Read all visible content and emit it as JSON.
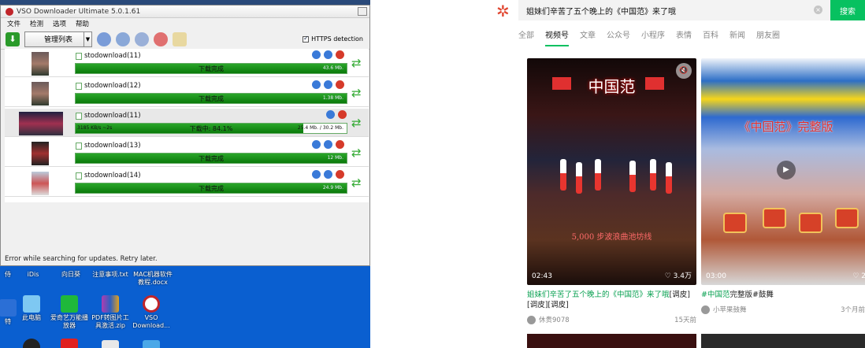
{
  "vso": {
    "title": "VSO Downloader Ultimate 5.0.1.61",
    "menu": [
      "文件",
      "检测",
      "选项",
      "帮助"
    ],
    "manage_label": "管理列表",
    "https_label": "HTTPS detection",
    "status": "Error while searching for updates. Retry later.",
    "rows": [
      {
        "name": "stodownload(11)",
        "status": "下载完成",
        "size": "43.6 Mb.",
        "progress": 1.0
      },
      {
        "name": "stodownload(12)",
        "status": "下载完成",
        "size": "1.38 Mb.",
        "progress": 1.0
      },
      {
        "name": "stodownload(11)",
        "status": "下载中: 84.1%",
        "size": "25.4 Mb. / 30.2 Mb.",
        "speed": "3185 KB/s ~2s",
        "progress": 0.841
      },
      {
        "name": "stodownload(13)",
        "status": "下载完成",
        "size": "12 Mb.",
        "progress": 1.0
      },
      {
        "name": "stodownload(14)",
        "status": "下载完成",
        "size": "24.9 Mb.",
        "progress": 1.0
      }
    ]
  },
  "desktop": {
    "top_labels": [
      "侍",
      "iDis",
      "向日葵",
      "注意事项.txt",
      "MAC机器软件教程.docx"
    ],
    "icons": [
      "特",
      "此电脑",
      "爱奇艺万能播放器",
      "PDF转图片工具激活.zip",
      "VSO Download..."
    ]
  },
  "search": {
    "query": "姐妹们辛苦了五个晚上的《中国范》来了哦",
    "button": "搜索",
    "tabs": [
      "全部",
      "视频号",
      "文章",
      "公众号",
      "小程序",
      "表情",
      "百科",
      "新闻",
      "朋友圈"
    ],
    "active_tab": 1
  },
  "cards": [
    {
      "banner": "中国范",
      "subtitle": "5,000 步波浪曲池坊线",
      "duration": "02:43",
      "likes": "♡ 3.4万",
      "caption_hl": "姐妹们辛苦了五个晚上的《中国范》来了哦",
      "caption_rest": "[调皮][调皮][调皮]",
      "author": "休贵9078",
      "time": "15天前"
    },
    {
      "banner": "《中国范》完整版",
      "duration": "03:00",
      "likes": "♡ 2",
      "caption_hl": "#中国范",
      "caption_rest": "完整版#鼓舞",
      "author": "小苹果鼓舞",
      "time": "3个月前"
    }
  ],
  "colors": {
    "accent": "#07c160",
    "progress": "#0a7a0a",
    "desktop": "#0a5fd0"
  }
}
